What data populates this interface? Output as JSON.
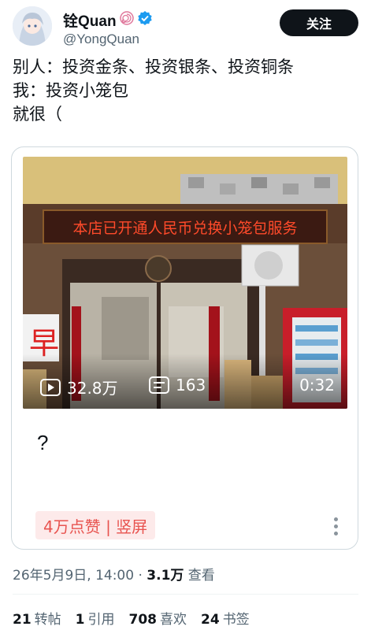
{
  "header": {
    "display_name": "铨Quan",
    "handle": "@YongQuan",
    "follow_label": "关注"
  },
  "post": {
    "lines": [
      "别人：投资金条、投资银条、投资铜条",
      "我：投资小笼包",
      "就很（"
    ]
  },
  "card": {
    "sign_text": "本店已开通人民币兑换小笼包服务",
    "views": "32.8万",
    "comments": "163",
    "duration": "0:32",
    "question": "?",
    "tag": "4万点赞 | 竖屏"
  },
  "meta": {
    "datetime": "26年5月9日, 14:00 · ",
    "views_count": "3.1万",
    "views_label": " 查看"
  },
  "stats": {
    "retweets": "21",
    "retweets_label": "转帖",
    "quotes": "1",
    "quotes_label": "引用",
    "likes": "708",
    "likes_label": "喜欢",
    "bookmarks": "24",
    "bookmarks_label": "书签"
  },
  "colors": {
    "accent": "#1d9bf0",
    "tag_text": "#e8534f",
    "tag_bg": "#fdeaea"
  }
}
